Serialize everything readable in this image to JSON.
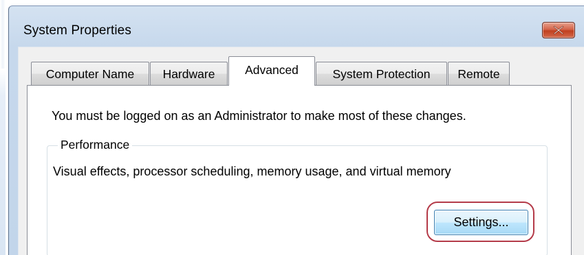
{
  "window": {
    "title": "System Properties",
    "close_icon": "close-icon"
  },
  "tabs": [
    {
      "label": "Computer Name",
      "active": false
    },
    {
      "label": "Hardware",
      "active": false
    },
    {
      "label": "Advanced",
      "active": true
    },
    {
      "label": "System Protection",
      "active": false
    },
    {
      "label": "Remote",
      "active": false
    }
  ],
  "advanced": {
    "admin_notice": "You must be logged on as an Administrator to make most of these changes.",
    "performance": {
      "group_label": "Performance",
      "description": "Visual effects, processor scheduling, memory usage, and virtual memory",
      "settings_label": "Settings..."
    }
  },
  "colors": {
    "highlight_ring": "#b43a48",
    "close_button": "#c0401f",
    "button_border": "#3c7fb1"
  }
}
